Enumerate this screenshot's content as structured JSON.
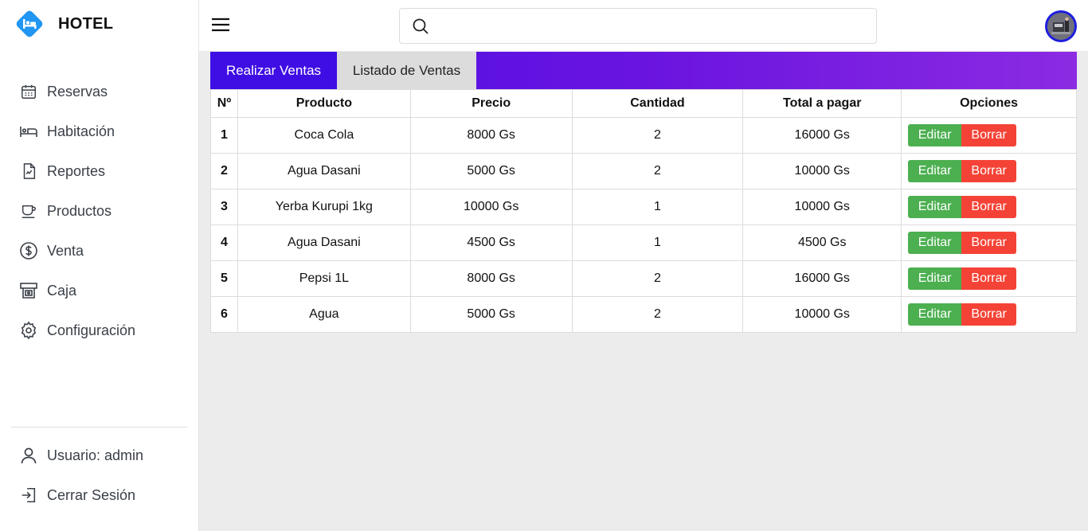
{
  "brand": {
    "name": "HOTEL"
  },
  "sidebar": {
    "items": [
      {
        "label": "Reservas",
        "icon": "calendar-icon"
      },
      {
        "label": "Habitación",
        "icon": "bed-icon"
      },
      {
        "label": "Reportes",
        "icon": "report-icon"
      },
      {
        "label": "Productos",
        "icon": "cup-icon"
      },
      {
        "label": "Venta",
        "icon": "dollar-icon"
      },
      {
        "label": "Caja",
        "icon": "cash-register-icon"
      },
      {
        "label": "Configuración",
        "icon": "gear-icon"
      }
    ],
    "footer": [
      {
        "label": "Usuario: admin",
        "icon": "user-icon"
      },
      {
        "label": "Cerrar Sesión",
        "icon": "logout-icon"
      }
    ]
  },
  "search": {
    "placeholder": "",
    "value": ""
  },
  "tabs": [
    {
      "label": "Realizar Ventas",
      "active": true
    },
    {
      "label": "Listado de Ventas",
      "active": false
    }
  ],
  "table": {
    "headers": [
      "Nº",
      "Producto",
      "Precio",
      "Cantidad",
      "Total a pagar",
      "Opciones"
    ],
    "rows": [
      {
        "n": "1",
        "producto": "Coca Cola",
        "precio": "8000 Gs",
        "cantidad": "2",
        "total": "16000 Gs"
      },
      {
        "n": "2",
        "producto": "Agua Dasani",
        "precio": "5000 Gs",
        "cantidad": "2",
        "total": "10000 Gs"
      },
      {
        "n": "3",
        "producto": "Yerba Kurupi 1kg",
        "precio": "10000 Gs",
        "cantidad": "1",
        "total": "10000 Gs"
      },
      {
        "n": "4",
        "producto": "Agua Dasani",
        "precio": "4500 Gs",
        "cantidad": "1",
        "total": "4500 Gs"
      },
      {
        "n": "5",
        "producto": "Pepsi 1L",
        "precio": "8000 Gs",
        "cantidad": "2",
        "total": "16000 Gs"
      },
      {
        "n": "6",
        "producto": "Agua",
        "precio": "5000 Gs",
        "cantidad": "2",
        "total": "10000 Gs"
      }
    ],
    "edit_label": "Editar",
    "delete_label": "Borrar"
  },
  "colors": {
    "brand": "#2196f3",
    "tab_gradient_start": "#4a0ee6",
    "tab_gradient_end": "#8b2be2",
    "edit": "#4caf50",
    "delete": "#f44336",
    "avatar_ring": "#1d1de0"
  }
}
